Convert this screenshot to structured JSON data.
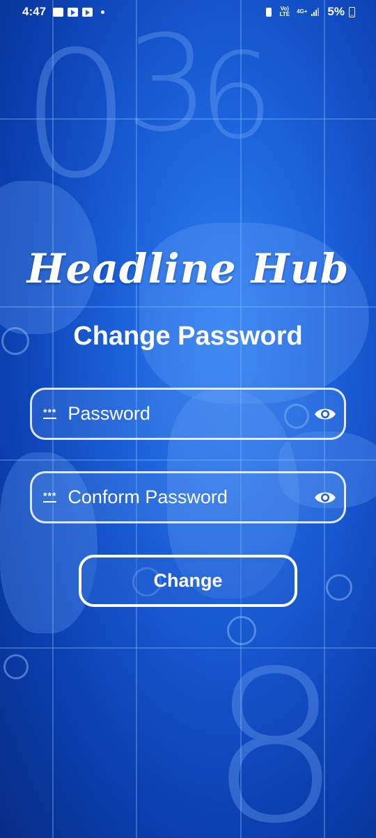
{
  "status_bar": {
    "time": "4:47",
    "network_top": "Vo)",
    "network_bottom": "LTE",
    "net_type": "4G+",
    "battery_percent": "5%"
  },
  "app": {
    "title": "Headline Hub",
    "screen_title": "Change Password"
  },
  "form": {
    "password": {
      "placeholder": "Password",
      "value": "",
      "icon": "password-icon"
    },
    "confirm_password": {
      "placeholder": "Conform Password",
      "value": "",
      "icon": "password-icon"
    },
    "toggle_icon": "eye-icon",
    "submit_label": "Change"
  },
  "colors": {
    "background": "#1a5fd8",
    "text": "#ffffff",
    "battery_low": "#ff4a3d"
  }
}
